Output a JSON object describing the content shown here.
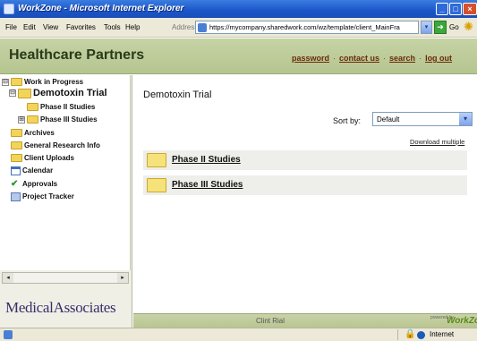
{
  "window": {
    "title": "WorkZone - Microsoft Internet Explorer",
    "minimize_glyph": "_",
    "maximize_glyph": "□",
    "close_glyph": "×"
  },
  "menu": {
    "items": [
      "File",
      "Edit",
      "View",
      "Favorites",
      "Tools",
      "Help"
    ],
    "address_label": "Address",
    "address_value": "https://mycompany.sharedwork.com/wz/template/client_MainFra",
    "go_label": "Go"
  },
  "header": {
    "brand": "Healthcare Partners",
    "links": [
      "password",
      "contact us",
      "search",
      "log out"
    ],
    "separator": "·"
  },
  "tree": {
    "items": [
      {
        "label": "Work in Progress",
        "toggle": "⊟"
      },
      {
        "label": "Demotoxin Trial",
        "toggle": "⊟"
      },
      {
        "label": "Phase II Studies",
        "toggle": ""
      },
      {
        "label": "Phase III Studies",
        "toggle": "⊞"
      },
      {
        "label": "Archives",
        "toggle": ""
      },
      {
        "label": "General Research Info",
        "toggle": ""
      },
      {
        "label": "Client Uploads",
        "toggle": ""
      },
      {
        "label": "Calendar",
        "toggle": ""
      },
      {
        "label": "Approvals",
        "toggle": ""
      },
      {
        "label": "Project Tracker",
        "toggle": ""
      }
    ]
  },
  "scroll": {
    "left_glyph": "◂",
    "right_glyph": "▸"
  },
  "logo": {
    "text": "MedicalAssociates"
  },
  "main": {
    "title": "Demotoxin Trial",
    "sort_label": "Sort by:",
    "sort_value": "Default",
    "dropdown_glyph": "▾",
    "download_link": "Download multiple",
    "folders": [
      {
        "label": "Phase II Studies"
      },
      {
        "label": "Phase III Studies"
      }
    ]
  },
  "footer": {
    "center_text": "Clint Rial",
    "powered_small": "powered by",
    "powered_brand": "WorkZone"
  },
  "status": {
    "zone": "Internet",
    "lock_glyph": "🔒"
  },
  "colors": {
    "title_bar": "#1b55c9",
    "header_bg": "#c6d3a6",
    "folder": "#f6e27a"
  }
}
